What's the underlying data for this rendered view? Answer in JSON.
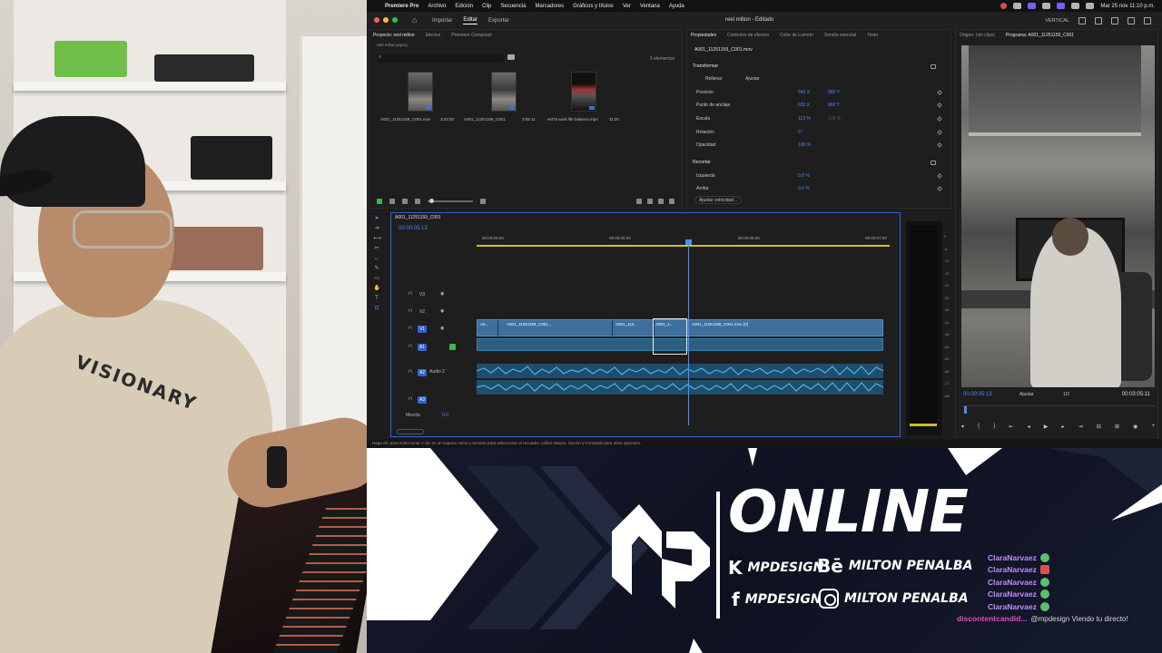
{
  "menubar": {
    "app_name": "Premiere Pro",
    "items": [
      "Archivo",
      "Edición",
      "Clip",
      "Secuencia",
      "Marcadores",
      "Gráficos y títulos",
      "Ver",
      "Ventana",
      "Ayuda"
    ],
    "clock": "Mar 25 nov 11:10 p.m."
  },
  "titlebar": {
    "workspace_tabs": [
      "Importar",
      "Editar",
      "Exportar"
    ],
    "active_tab": "Editar",
    "project_title": "reel milton - Editado",
    "layout_label": "VERTICAL"
  },
  "project_panel": {
    "tabs": [
      "Proyecto: reel milton",
      "Efectos",
      "Premiere Composer"
    ],
    "breadcrumb": "reel milton.prproj",
    "count": "3 elementos",
    "clips": [
      {
        "name": "A001_11251159_C001.mov",
        "duration": "3:42:02"
      },
      {
        "name": "A001_11251159_C001",
        "duration": "3:05:11"
      },
      {
        "name": "est?a work life balance.mp4",
        "duration": "11:20"
      }
    ]
  },
  "properties_panel": {
    "tabs": [
      "Propiedades",
      "Controles de efectos",
      "Color de Lumetri",
      "Sonido esencial",
      "Texto"
    ],
    "file": "A001_11251159_C001.mov",
    "transform_label": "Transformar",
    "fill_label": "Rellenar",
    "fit_label": "Ajustar",
    "rows": [
      {
        "label": "Posición",
        "v1": "540 X",
        "v2": "960 Y"
      },
      {
        "label": "Punto de anclaje",
        "v1": "632 X",
        "v2": "960 Y"
      },
      {
        "label": "Escala",
        "v1": "113 %",
        "v2": "100 %"
      },
      {
        "label": "Rotación",
        "v1": "0 °",
        "v2": ""
      },
      {
        "label": "Opacidad",
        "v1": "100 %",
        "v2": ""
      }
    ],
    "crop_label": "Recortar",
    "crop_rows": [
      {
        "label": "Izquierda",
        "v1": "0.0 %"
      },
      {
        "label": "Arriba",
        "v1": "0.0 %"
      }
    ],
    "speed_button": "Ajustar velocidad..."
  },
  "program_monitor": {
    "tabs": [
      "Origen: (sin clips)",
      "Programa: A001_11251159_C001"
    ],
    "timecode": "00:00:05:13",
    "fit": "Ajustar",
    "ratio": "1/2",
    "duration": "00:03:05:11"
  },
  "timeline": {
    "sequence_name": "A001_11251159_C001",
    "timecode": "00:00:05:13",
    "ruler": [
      "00:00:04:00",
      "00:00:05:00",
      "00:00:06:00",
      "00:00:07:00"
    ],
    "tracks": [
      "V3",
      "V2",
      "V1",
      "A1",
      "A2",
      "A3"
    ],
    "audio_track_label": "Audio 2",
    "clip_labels": [
      "A0...",
      "A001_11251159_C001...",
      "A001_112...",
      "A001_1...",
      "A001_11251159_C001.mov [V]"
    ],
    "mix_label": "Mezcla",
    "mix_value": "0.0"
  },
  "meters": {
    "scale": [
      "0",
      "-6",
      "-12",
      "-18",
      "-24",
      "-30",
      "-36",
      "-42",
      "-48",
      "-54",
      "-60",
      "-66",
      "-72",
      "-dB"
    ]
  },
  "statusbar": {
    "text": "Haga clic para seleccionar o clic en un espacio vacío y arrastre para seleccionar el recuadro. Utilice Mayús, Opción y Comando para otras opciones."
  },
  "overlay": {
    "status": "ONLINE",
    "behance_handle": "MPDESIGN",
    "behance_name": "MILTON PENALBA",
    "facebook_handle": "MPDESIGN",
    "instagram_name": "MILTON PENALBA",
    "chat": [
      {
        "user": "ClaraNarvaez",
        "badge": "green",
        "msg": ""
      },
      {
        "user": "ClaraNarvaez",
        "badge": "red",
        "msg": ""
      },
      {
        "user": "ClaraNarvaez",
        "badge": "green",
        "msg": ""
      },
      {
        "user": "ClaraNarvaez",
        "badge": "green",
        "msg": ""
      },
      {
        "user": "ClaraNarvaez",
        "badge": "green",
        "msg": ""
      },
      {
        "user": "discontentcandid...",
        "badge": "",
        "msg": "@mpdesign Viendo tu directo!"
      }
    ]
  }
}
